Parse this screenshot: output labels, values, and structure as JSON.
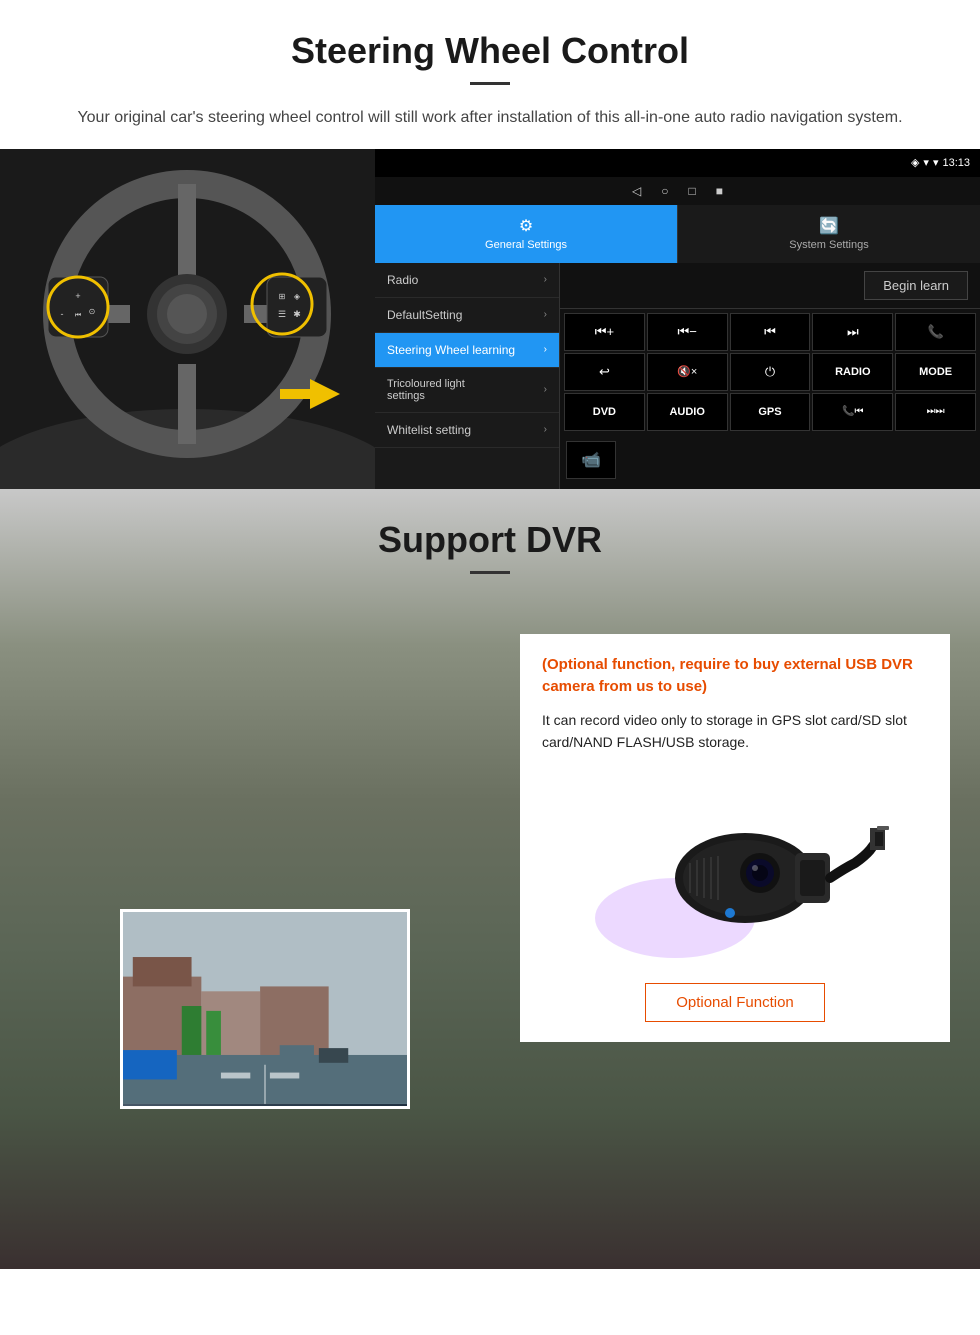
{
  "page": {
    "section1": {
      "title": "Steering Wheel Control",
      "subtitle": "Your original car's steering wheel control will still work after installation of this all-in-one auto radio navigation system."
    },
    "section2": {
      "title": "Support DVR",
      "optional_text": "(Optional function, require to buy external USB DVR camera from us to use)",
      "desc_text": "It can record video only to storage in GPS slot card/SD slot card/NAND FLASH/USB storage.",
      "optional_btn": "Optional Function"
    }
  },
  "android_ui": {
    "status_bar": {
      "time": "13:13",
      "signal_icon": "📶",
      "wifi_icon": "▾",
      "location_icon": "◈"
    },
    "nav_bar": {
      "back": "◁",
      "home": "○",
      "square": "□",
      "record": "■"
    },
    "tabs": [
      {
        "label": "General Settings",
        "icon": "⚙",
        "active": true
      },
      {
        "label": "System Settings",
        "icon": "🔁",
        "active": false
      }
    ],
    "menu_items": [
      {
        "label": "Radio",
        "active": false
      },
      {
        "label": "DefaultSetting",
        "active": false
      },
      {
        "label": "Steering Wheel learning",
        "active": true
      },
      {
        "label": "Tricoloured light settings",
        "active": false
      },
      {
        "label": "Whitelist setting",
        "active": false
      }
    ],
    "begin_learn": "Begin learn",
    "control_buttons": [
      "⏮+",
      "⏮-",
      "⏮",
      "⏭",
      "📞",
      "↩",
      "🔇",
      "⏻",
      "RADIO",
      "MODE",
      "DVD",
      "AUDIO",
      "GPS",
      "📞⏮",
      "⏭⏭",
      "📹"
    ]
  }
}
